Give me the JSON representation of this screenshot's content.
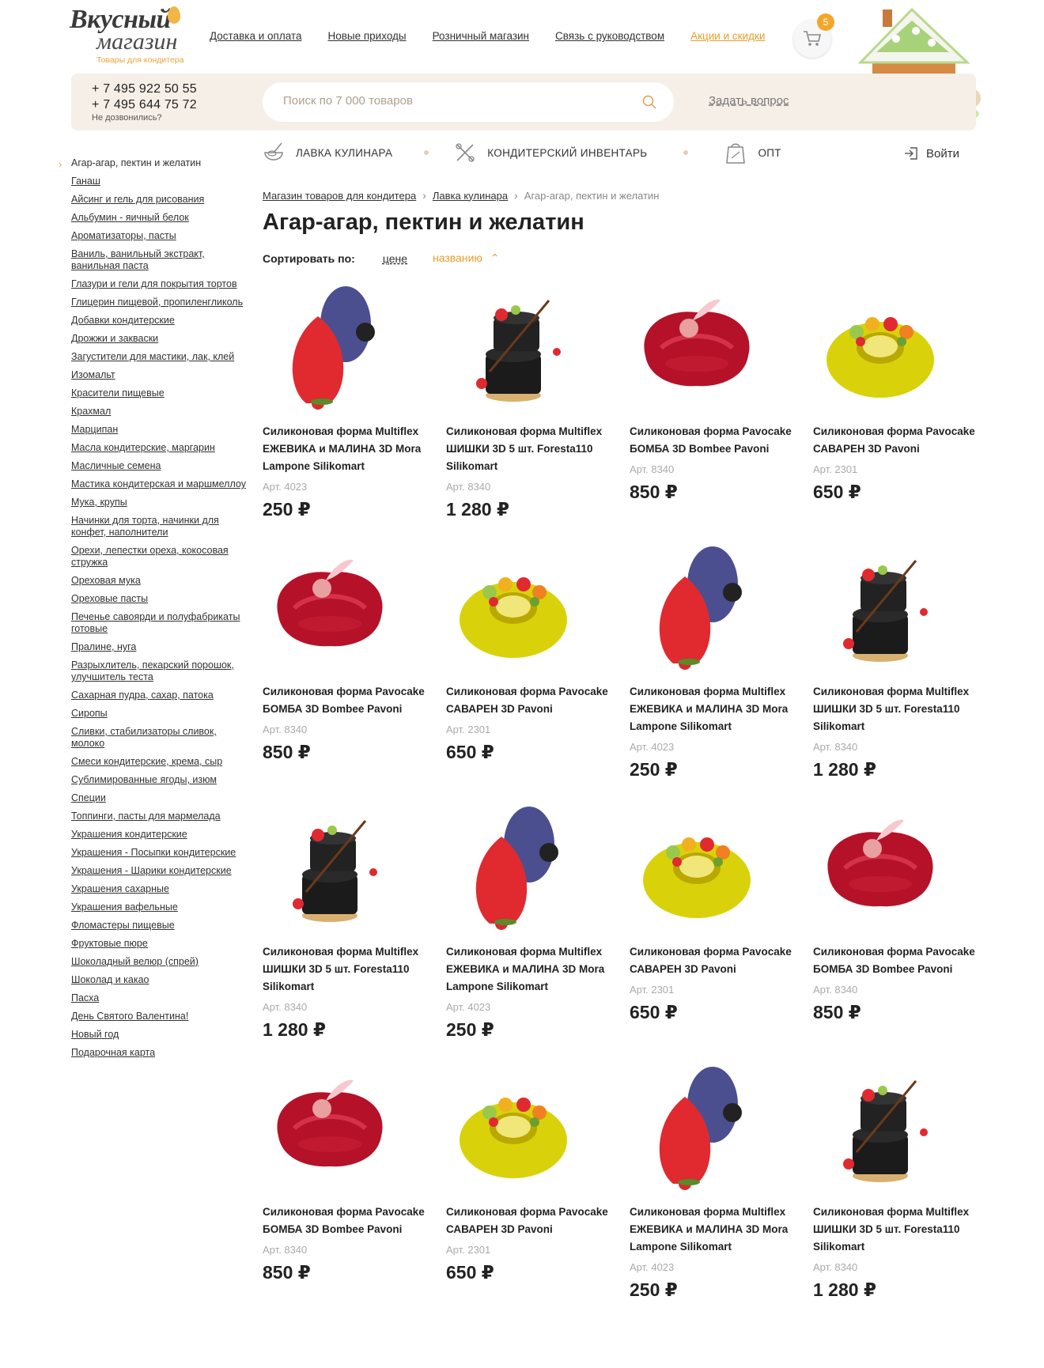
{
  "header": {
    "logo": {
      "main": "Вкусный",
      "sub": "магазин",
      "tagline": "Товары для кондитера"
    },
    "nav": [
      "Доставка и оплата",
      "Новые приходы",
      "Розничный магазин",
      "Связь с руководством",
      "Акции и скидки"
    ],
    "cart_count": "5",
    "phones": [
      "+ 7 495 922 50 55",
      "+ 7 495 644 75 72"
    ],
    "phone_note": "Не дозвонились?",
    "search_placeholder": "Поиск по 7 000 товаров",
    "ask_label": "Задать вопрос"
  },
  "categories": [
    "ЛАВКА КУЛИНАРА",
    "КОНДИТЕРСКИЙ ИНВЕНТАРЬ",
    "ОПТ"
  ],
  "login_label": "Войти",
  "sidebar": [
    "Агар-агар, пектин и желатин",
    "Ганаш",
    "Айсинг и гель для рисования",
    "Альбумин - яичный белок",
    "Ароматизаторы, пасты",
    "Ваниль, ванильный экстракт, ванильная паста",
    "Глазури и гели для покрытия тортов",
    "Глицерин пищевой, пропиленгликоль",
    "Добавки кондитерские",
    "Дрожжи и закваски",
    "Загустители для мастики, лак, клей",
    "Изомальт",
    "Красители пищевые",
    "Крахмал",
    "Марципан",
    "Масла кондитерские, маргарин",
    "Масличные семена",
    "Мастика кондитерская и маршмеллоу",
    "Мука, крупы",
    "Начинки для торта, начинки для конфет, наполнители",
    "Орехи, лепестки ореха, кокосовая стружка",
    "Ореховая мука",
    "Ореховые пасты",
    "Печенье савоярди и полуфабрикаты готовые",
    "Пралине, нуга",
    "Разрыхлитель, пекарский порошок, улучшитель теста",
    "Сахарная пудра, сахар, патока",
    "Сиропы",
    "Сливки, стабилизаторы сливок, молоко",
    "Смеси кондитерские, крема, сыр",
    "Сублимированные ягоды, изюм",
    "Специи",
    "Топпинги, пасты для мармелада",
    "Украшения кондитерские",
    "Украшения - Посыпки кондитерские",
    "Украшения - Шарики кондитерские",
    "Украшения сахарные",
    "Украшения вафельные",
    "Фломастеры пищевые",
    "Фруктовые пюре",
    "Шоколадный велюр (спрей)",
    "Шоколад и какао",
    "Пасха",
    "День Святого Валентина!",
    "Новый год",
    "Подарочная карта"
  ],
  "breadcrumb": [
    "Магазин товаров для кондитера",
    "Лавка кулинара",
    "Агар-агар, пектин и желатин"
  ],
  "page_title": "Агар-агар, пектин и желатин",
  "sort": {
    "label": "Сортировать по:",
    "options": [
      "цене",
      "названию"
    ]
  },
  "products": [
    {
      "name": "Силиконовая форма Multiflex ЕЖЕВИКА и МАЛИНА 3D Mora Lampone Silikomart",
      "art": "Арт. 4023",
      "price": "250 ₽",
      "img": "raspberry-icon"
    },
    {
      "name": "Силиконовая форма Multiflex ШИШКИ 3D 5 шт. Foresta110 Silikomart",
      "art": "Арт. 8340",
      "price": "1 280 ₽",
      "img": "chocolate-cake-icon"
    },
    {
      "name": "Силиконовая форма Pavocake БОМБА 3D Bombee Pavoni",
      "art": "Арт. 8340",
      "price": "850 ₽",
      "img": "red-cake-icon"
    },
    {
      "name": "Силиконовая форма Pavocake САВАРЕН 3D Pavoni",
      "art": "Арт. 2301",
      "price": "650 ₽",
      "img": "yellow-ring-icon"
    },
    {
      "name": "Силиконовая форма Pavocake БОМБА 3D Bombee Pavoni",
      "art": "Арт. 8340",
      "price": "850 ₽",
      "img": "red-cake-icon"
    },
    {
      "name": "Силиконовая форма Pavocake САВАРЕН 3D Pavoni",
      "art": "Арт. 2301",
      "price": "650 ₽",
      "img": "yellow-ring-icon"
    },
    {
      "name": "Силиконовая форма Multiflex ЕЖЕВИКА и МАЛИНА 3D Mora Lampone Silikomart",
      "art": "Арт. 4023",
      "price": "250 ₽",
      "img": "raspberry-icon"
    },
    {
      "name": "Силиконовая форма Multiflex ШИШКИ 3D 5 шт. Foresta110 Silikomart",
      "art": "Арт. 8340",
      "price": "1 280 ₽",
      "img": "chocolate-cake-icon"
    },
    {
      "name": "Силиконовая форма Multiflex ШИШКИ 3D 5 шт. Foresta110 Silikomart",
      "art": "Арт. 8340",
      "price": "1 280 ₽",
      "img": "chocolate-cake-icon"
    },
    {
      "name": "Силиконовая форма Multiflex ЕЖЕВИКА и МАЛИНА 3D Mora Lampone Silikomart",
      "art": "Арт. 4023",
      "price": "250 ₽",
      "img": "raspberry-icon"
    },
    {
      "name": "Силиконовая форма Pavocake САВАРЕН 3D Pavoni",
      "art": "Арт. 2301",
      "price": "650 ₽",
      "img": "yellow-ring-icon"
    },
    {
      "name": "Силиконовая форма Pavocake БОМБА 3D Bombee Pavoni",
      "art": "Арт. 8340",
      "price": "850 ₽",
      "img": "red-cake-icon"
    },
    {
      "name": "Силиконовая форма Pavocake БОМБА 3D Bombee Pavoni",
      "art": "Арт. 8340",
      "price": "850 ₽",
      "img": "red-cake-icon"
    },
    {
      "name": "Силиконовая форма Pavocake САВАРЕН 3D Pavoni",
      "art": "Арт. 2301",
      "price": "650 ₽",
      "img": "yellow-ring-icon"
    },
    {
      "name": "Силиконовая форма Multiflex ЕЖЕВИКА и МАЛИНА 3D Mora Lampone Silikomart",
      "art": "Арт. 4023",
      "price": "250 ₽",
      "img": "raspberry-icon"
    },
    {
      "name": "Силиконовая форма Multiflex ШИШКИ 3D 5 шт. Foresta110 Silikomart",
      "art": "Арт. 8340",
      "price": "1 280 ₽",
      "img": "chocolate-cake-icon"
    }
  ],
  "colors": {
    "accent": "#e89d2a",
    "infobar": "#f6efe7"
  }
}
